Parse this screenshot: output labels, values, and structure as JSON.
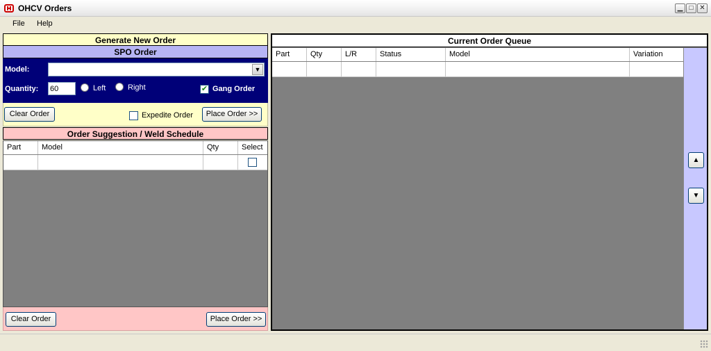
{
  "window": {
    "title": "OHCV Orders",
    "controls": {
      "minimize": "▁",
      "maximize": "□",
      "close": "✕"
    },
    "logo_icon": "honda-h-icon"
  },
  "menu": {
    "items": [
      "File",
      "Help"
    ]
  },
  "generate": {
    "header": "Generate New Order",
    "spo": {
      "header": "SPO Order",
      "model_label": "Model:",
      "model_value": "",
      "model_arrow": "▼",
      "quantity_label": "Quantity:",
      "quantity_value": "60",
      "left_label": "Left",
      "right_label": "Right",
      "gang_label": "Gang Order",
      "gang_check": "✔",
      "expedite_label": "Expedite Order",
      "clear_button": "Clear Order",
      "place_button": "Place Order >>"
    }
  },
  "suggestion": {
    "header": "Order Suggestion / Weld Schedule",
    "columns": [
      "Part",
      "Model",
      "Qty",
      "Select"
    ],
    "clear_button": "Clear Order",
    "place_button": "Place Order >>"
  },
  "queue": {
    "header": "Current Order Queue",
    "columns": [
      "Part",
      "Qty",
      "L/R",
      "Status",
      "Model",
      "Variation"
    ],
    "up_arrow": "▲",
    "down_arrow": "▼"
  },
  "colors": {
    "generate_header": "#ffffc8",
    "spo_header": "#b7b5f5",
    "spo_body": "#000078",
    "suggestion": "#ffc6c6",
    "queue_side": "#c8c8ff",
    "table_empty": "#808080"
  }
}
